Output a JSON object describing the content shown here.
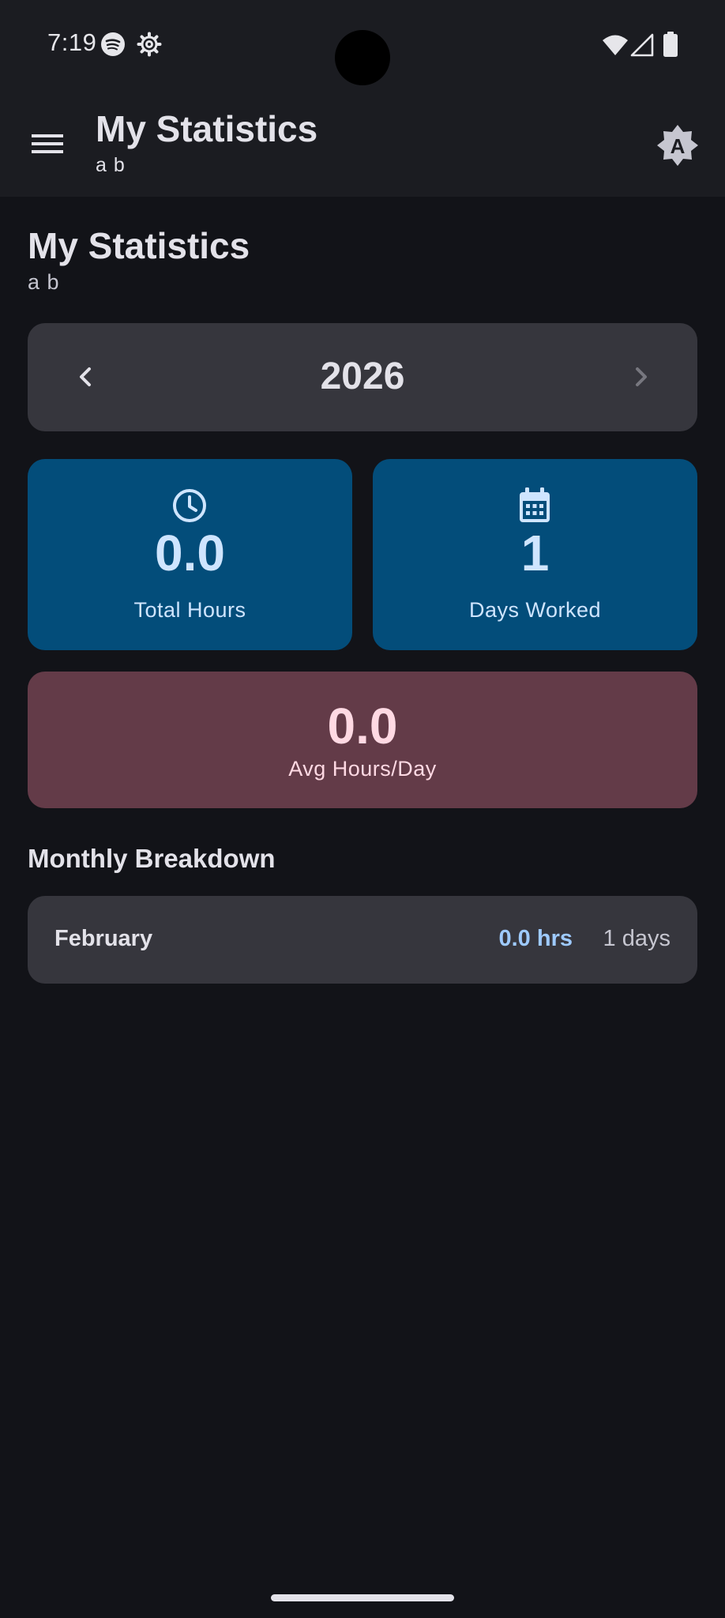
{
  "status_bar": {
    "time": "7:19",
    "icons": [
      "spotify-icon",
      "gear-icon",
      "wifi-icon",
      "signal-icon",
      "battery-icon"
    ]
  },
  "app_bar": {
    "title": "My Statistics",
    "subtitle": "a b",
    "menu_icon": "menu-icon",
    "theme_icon": "brightness-auto-icon"
  },
  "header": {
    "title": "My Statistics",
    "subtitle": "a b"
  },
  "year_selector": {
    "year": "2026",
    "prev_icon": "chevron-left-icon",
    "next_icon": "chevron-right-icon"
  },
  "stats": {
    "total_hours": {
      "value": "0.0",
      "label": "Total Hours",
      "icon": "clock-icon"
    },
    "days_worked": {
      "value": "1",
      "label": "Days Worked",
      "icon": "calendar-icon"
    },
    "avg_hours": {
      "value": "0.0",
      "label": "Avg Hours/Day"
    }
  },
  "monthly": {
    "title": "Monthly Breakdown",
    "rows": [
      {
        "month": "February",
        "hours": "0.0 hrs",
        "days": "1 days"
      }
    ]
  },
  "colors": {
    "background": "#121318",
    "surface": "#1b1c21",
    "card": "#36363d",
    "primary_container": "#034d7a",
    "tertiary_container": "#633b48",
    "accent": "#9ecaff"
  }
}
